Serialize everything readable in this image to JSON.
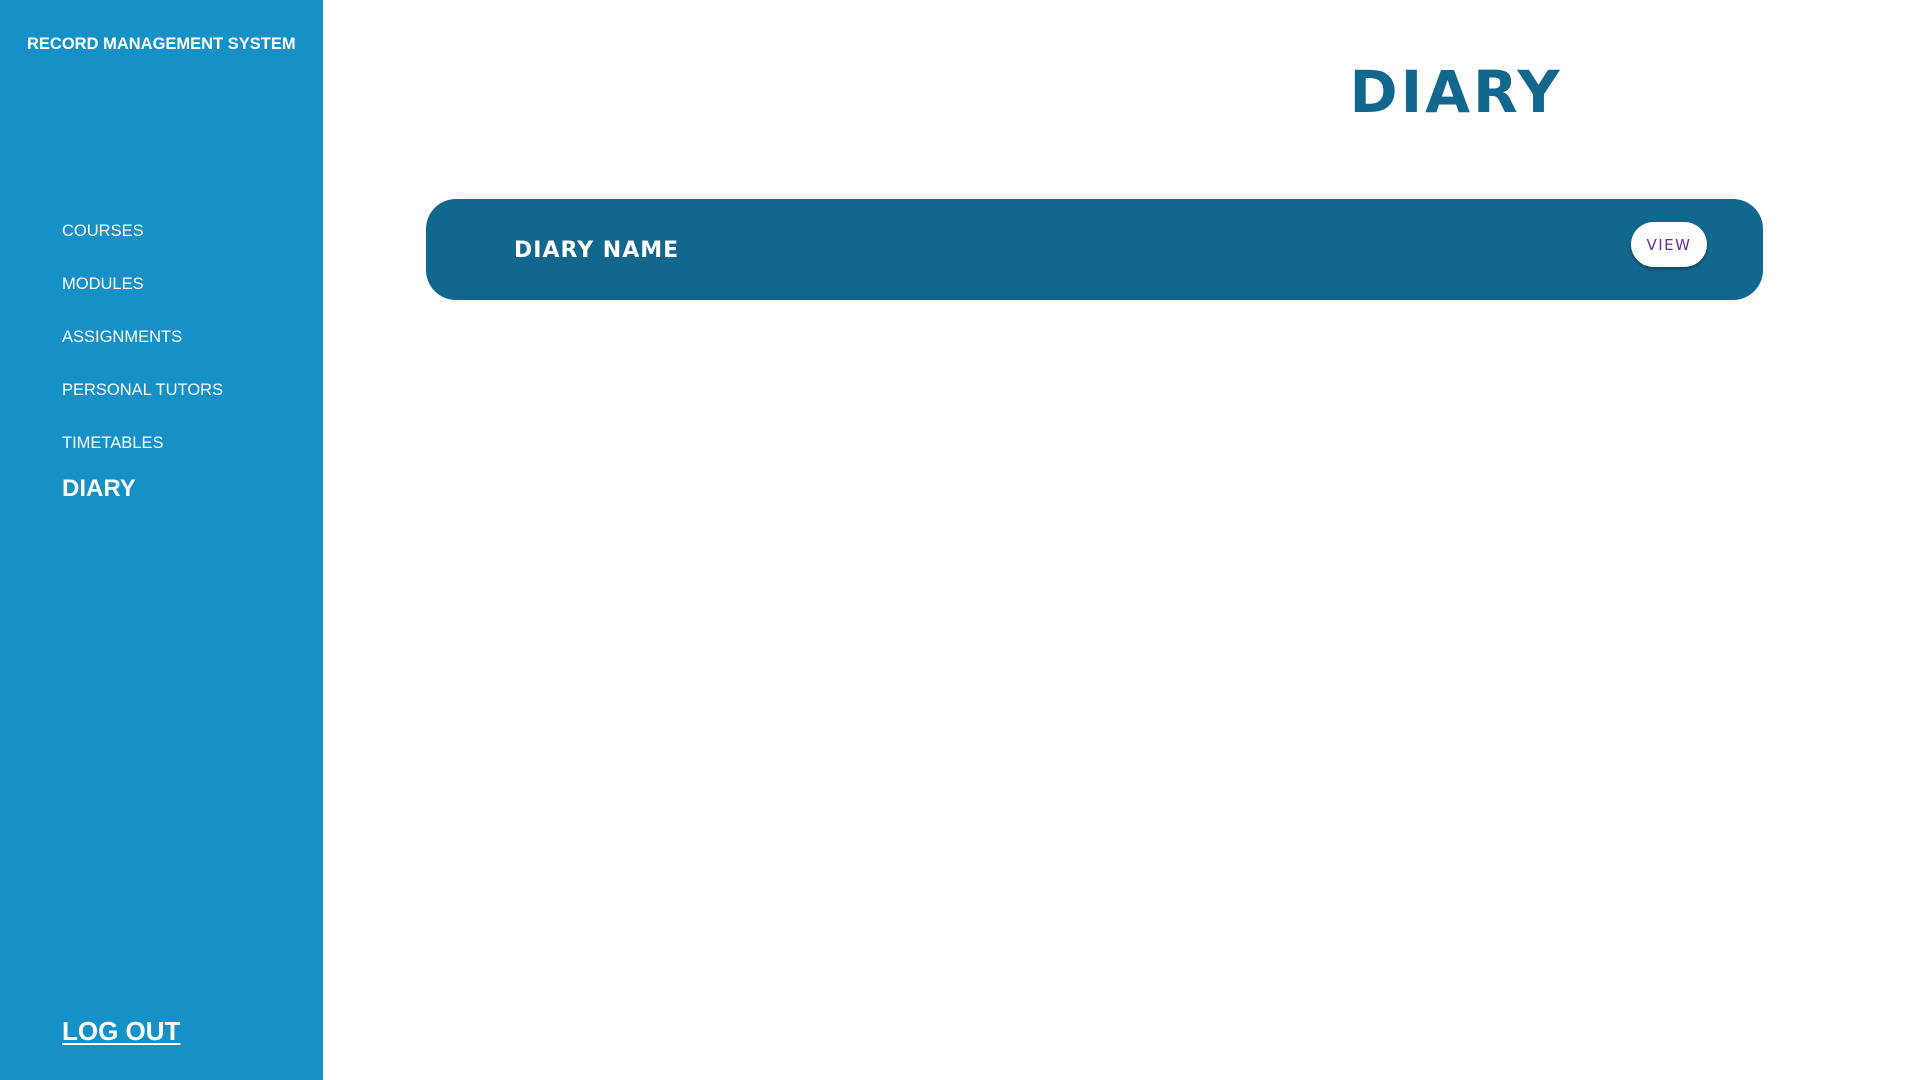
{
  "app": {
    "title": "RECORD MANAGEMENT SYSTEM"
  },
  "sidebar": {
    "items": [
      {
        "label": "COURSES",
        "active": false
      },
      {
        "label": "MODULES",
        "active": false
      },
      {
        "label": "ASSIGNMENTS",
        "active": false
      },
      {
        "label": "PERSONAL TUTORS",
        "active": false
      },
      {
        "label": "TIMETABLES",
        "active": false
      },
      {
        "label": "DIARY",
        "active": true
      }
    ],
    "logout_label": "LOG OUT"
  },
  "main": {
    "page_title": "DIARY",
    "diaries": [
      {
        "name": "DIARY NAME",
        "action_label": "VIEW"
      }
    ]
  },
  "colors": {
    "sidebar_bg": "#1591c7",
    "card_bg": "#12678e",
    "title_text": "#12678e",
    "view_text": "#6b2f9c",
    "page_bg": "#ffffff"
  }
}
